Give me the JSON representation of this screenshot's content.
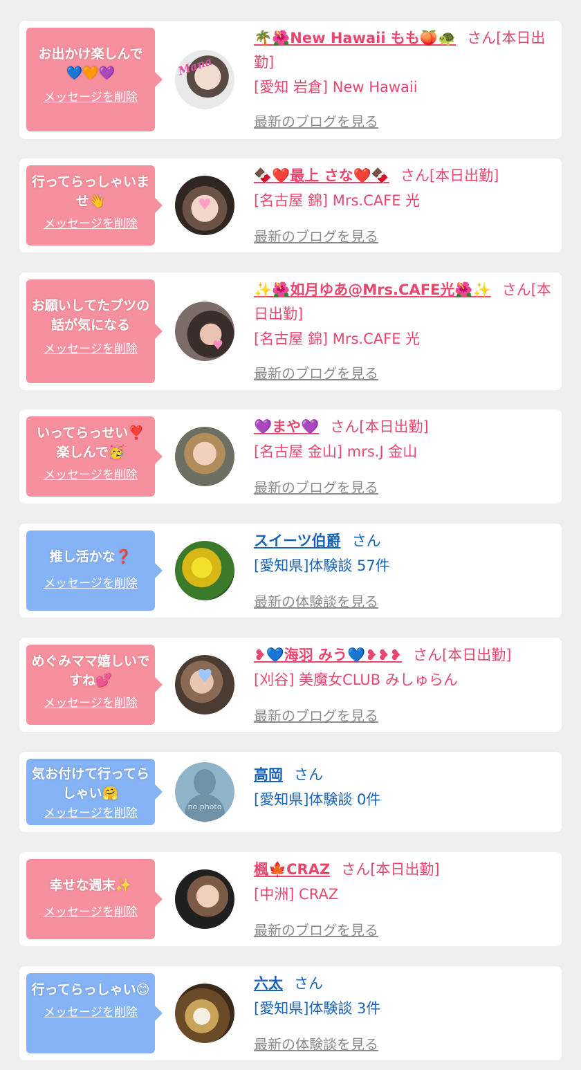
{
  "items": [
    {
      "type": "girl",
      "message": "お出かけ楽しんで💙🧡💜",
      "delete_label": "メッセージを削除",
      "name": "🌴🌺New Hawaii もも🍑🐢",
      "suffix": "さん[本日出勤]",
      "store": "[愛知 岩倉] New Hawaii",
      "link_label": "最新のブログを見る"
    },
    {
      "type": "girl",
      "message": "行ってらっしゃいませ👋",
      "delete_label": "メッセージを削除",
      "name": "🍫❤️最上 さな❤️🍫",
      "suffix": "さん[本日出勤]",
      "store": "[名古屋 錦] Mrs.CAFE 光",
      "link_label": "最新のブログを見る"
    },
    {
      "type": "girl",
      "message": "お願いしてたブツの話が気になる",
      "delete_label": "メッセージを削除",
      "name": "✨🌺如月ゆあ@Mrs.CAFE光🌺✨",
      "suffix": "さん[本日出勤]",
      "store": "[名古屋 錦] Mrs.CAFE 光",
      "link_label": "最新のブログを見る"
    },
    {
      "type": "girl",
      "message": "いってらっせい❣️楽しんで🥳",
      "delete_label": "メッセージを削除",
      "name": "💜まや💜",
      "suffix": "さん[本日出勤]",
      "store": "[名古屋 金山] mrs.J 金山",
      "link_label": "最新のブログを見る"
    },
    {
      "type": "user",
      "message": "推し活かな❓",
      "delete_label": "メッセージを削除",
      "name": "スイーツ伯爵",
      "suffix": "さん",
      "store": "[愛知県]体験談 57件",
      "link_label": "最新の体験談を見る"
    },
    {
      "type": "girl",
      "message": "めぐみママ嬉しいですね💕",
      "delete_label": "メッセージを削除",
      "name": "❥💙海羽 みう💙❥❥❥",
      "suffix": "さん[本日出勤]",
      "store": "[刈谷] 美魔女CLUB みしゅらん",
      "link_label": "最新のブログを見る"
    },
    {
      "type": "user",
      "message": "気お付けて行ってらしゃい🤗",
      "delete_label": "メッセージを削除",
      "name": "高岡",
      "suffix": "さん",
      "store": "[愛知県]体験談 0件",
      "link_label": "",
      "avatar_text": "no photo"
    },
    {
      "type": "girl",
      "message": "幸せな週末✨",
      "delete_label": "メッセージを削除",
      "name": "楓🍁CRAZ",
      "suffix": "さん[本日出勤]",
      "store": "[中洲] CRAZ",
      "link_label": "最新のブログを見る"
    },
    {
      "type": "user",
      "message": "行ってらっしゃい😊",
      "delete_label": "メッセージを削除",
      "name": "六太",
      "suffix": "さん",
      "store": "[愛知県]体験談 3件",
      "link_label": "最新の体験談を見る"
    }
  ],
  "colors": {
    "pink_bubble": "#f7909e",
    "blue_bubble": "#86b3f5",
    "pink_text": "#e8466e",
    "blue_text": "#1763b8",
    "link_gray": "#8c8c8c",
    "page_bg": "#efefef"
  }
}
